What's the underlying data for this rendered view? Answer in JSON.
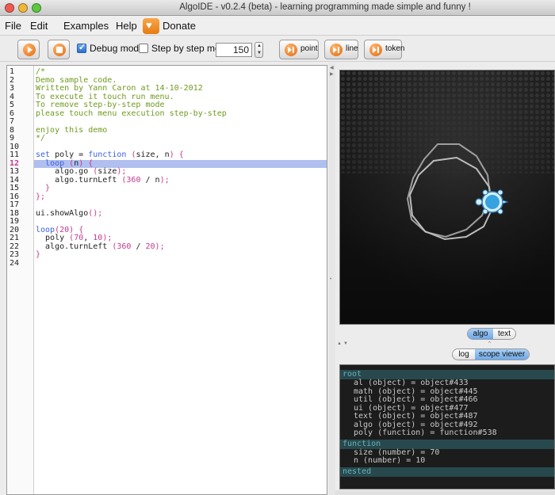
{
  "window": {
    "title": "AlgoIDE - v0.2.4 (beta) - learning programming made simple and funny !"
  },
  "menubar": {
    "items": [
      {
        "label": "File"
      },
      {
        "label": "Edit"
      },
      {
        "label": "Examples"
      },
      {
        "label": "Help"
      },
      {
        "label": "Donate"
      }
    ]
  },
  "toolbar": {
    "debug_mode_label": "Debug mode",
    "debug_mode_checked": true,
    "step_mode_label": "Step by step mode",
    "step_mode_checked": false,
    "speed_value": "150",
    "point_label": "point",
    "line_label": "line",
    "token_label": "token"
  },
  "editor": {
    "highlighted_line": 12,
    "lines": [
      "/*",
      "Demo sample code.",
      "Written by Yann Caron at 14-10-2012",
      "To execute it touch run menu.",
      "To remove step-by-step mode",
      "please touch menu execution step-by-step",
      "",
      "enjoy this demo",
      "*/",
      "",
      "set poly = function (size, n) {",
      "  loop (n) {",
      "    algo.go (size);",
      "    algo.turnLeft (360 / n);",
      "  }",
      "};",
      "",
      "ui.showAlgo();",
      "",
      "loop(20) {",
      "  poly (70, 10);",
      "  algo.turnLeft (360 / 20);",
      "}",
      ""
    ]
  },
  "view_switch": {
    "algo": "algo",
    "text": "text",
    "active": "algo"
  },
  "console_switch": {
    "log": "log",
    "scope_viewer": "scope viewer",
    "active": "scope viewer"
  },
  "scope_viewer": {
    "sections": [
      {
        "name": "root",
        "lines": [
          "al (object) = object#433",
          "math (object) = object#445",
          "util (object) = object#466",
          "ui (object) = object#477",
          "text (object) = object#487",
          "algo (object) = object#492",
          "poly (function) = function#538"
        ]
      },
      {
        "name": "function",
        "lines": [
          "size (number) = 70",
          "n (number) = 10"
        ]
      },
      {
        "name": "nested",
        "lines": []
      }
    ]
  },
  "colors": {
    "comment": "#6f9a1f",
    "keyword": "#3c5fe0",
    "number": "#c43a8d",
    "highlight": "#b0bff0",
    "scope_header_bg": "#27494e",
    "scope_header_fg": "#67b1ba",
    "turtle": "#35a3e0"
  }
}
